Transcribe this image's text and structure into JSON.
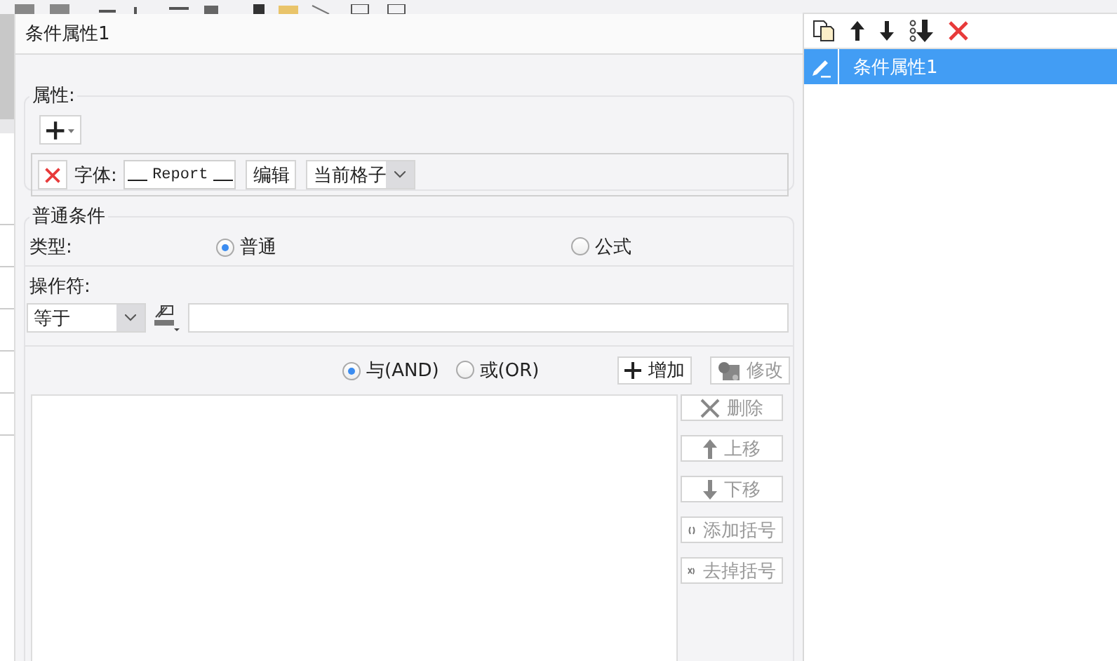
{
  "dialog": {
    "title": "条件属性1"
  },
  "properties": {
    "title": "属性:",
    "rows": [
      {
        "label": "字体:",
        "preview": "Report",
        "edit_button": "编辑",
        "scope": "当前格子"
      }
    ]
  },
  "condition": {
    "title": "普通条件",
    "type_label": "类型:",
    "types": [
      {
        "label": "普通",
        "selected": true
      },
      {
        "label": "公式",
        "selected": false
      }
    ],
    "operator_label": "操作符:",
    "operator": "等于",
    "joins": [
      {
        "label": "与(AND)",
        "selected": true
      },
      {
        "label": "或(OR)",
        "selected": false
      }
    ],
    "actions": [
      {
        "kind": "add",
        "label": "增加",
        "disabled": false
      },
      {
        "kind": "modify",
        "label": "修改",
        "disabled": true
      }
    ],
    "list_actions": [
      {
        "kind": "delete",
        "label": "删除",
        "disabled": true
      },
      {
        "kind": "up",
        "label": "上移",
        "disabled": true
      },
      {
        "kind": "down",
        "label": "下移",
        "disabled": true
      },
      {
        "kind": "add_paren",
        "label": "添加括号",
        "disabled": true
      },
      {
        "kind": "remove_paren",
        "label": "去掉括号",
        "disabled": true
      }
    ]
  },
  "conditions_list": {
    "items": [
      {
        "name": "条件属性1",
        "selected": true
      }
    ]
  }
}
